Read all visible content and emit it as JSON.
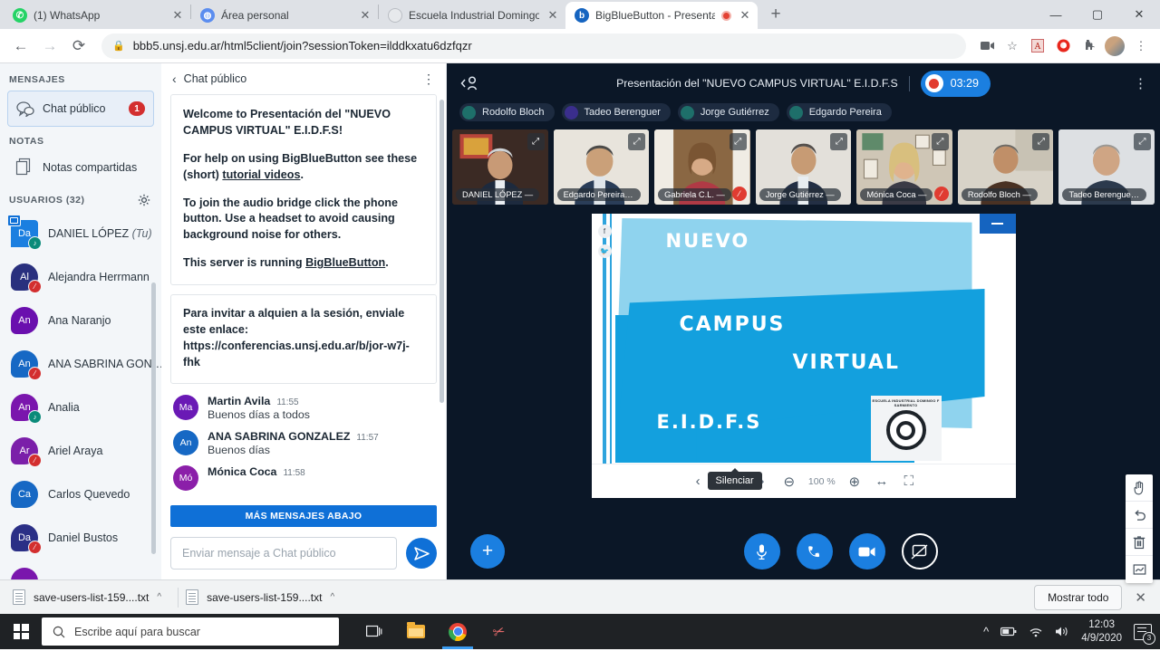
{
  "browser": {
    "tabs": [
      {
        "title": "(1) WhatsApp",
        "favicon": "whatsapp-icon",
        "active": false,
        "recording": false
      },
      {
        "title": "Área personal",
        "favicon": "globe-icon",
        "active": false,
        "recording": false
      },
      {
        "title": "Escuela Industrial Domingo Faust",
        "favicon": "page-icon",
        "active": false,
        "recording": false
      },
      {
        "title": "BigBlueButton - Presentació",
        "favicon": "bigbluebutton-icon",
        "active": true,
        "recording": true
      }
    ],
    "new_tab_label": "+",
    "close_label": "✕",
    "window_controls": {
      "minimize": "—",
      "maximize": "▢",
      "close": "✕"
    },
    "url": "bbb5.unsj.edu.ar/html5client/join?sessionToken=ilddkxatu6dzfqzr",
    "back_label": "←",
    "forward_label": "→",
    "reload_label": "⟳",
    "lock_label": "🔒",
    "toolbar_icons": [
      "camera-icon",
      "bookmark-star-icon",
      "pdf-icon",
      "adblock-icon",
      "extensions-puzzle-icon",
      "profile-avatar",
      "chrome-menu-icon"
    ]
  },
  "sidebar": {
    "messages_label": "MENSAJES",
    "chat_item": {
      "label": "Chat público",
      "unread": "1",
      "icon": "chat-bubbles-icon"
    },
    "notes_label": "NOTAS",
    "notes_item": {
      "label": "Notas compartidas",
      "icon": "notes-pages-icon"
    },
    "users_label": "USUARIOS (32)",
    "settings_icon": "gear-icon",
    "users": [
      {
        "initials": "Da",
        "name": "DANIEL LÓPEZ",
        "suffix": "(Tu)",
        "color": "#1b7fe0",
        "shape": "square",
        "badge": "audio",
        "presenter": true
      },
      {
        "initials": "Al",
        "name": "Alejandra Herrmann",
        "suffix": "",
        "color": "#29307e",
        "shape": "bubble",
        "badge": "muted",
        "presenter": false
      },
      {
        "initials": "An",
        "name": "Ana Naranjo",
        "suffix": "",
        "color": "#6a0fae",
        "shape": "bubble",
        "badge": "none",
        "presenter": false
      },
      {
        "initials": "An",
        "name": "ANA SABRINA GON…",
        "suffix": "",
        "color": "#1668c4",
        "shape": "bubble",
        "badge": "muted",
        "presenter": false
      },
      {
        "initials": "An",
        "name": "Analia",
        "suffix": "",
        "color": "#7a16ad",
        "shape": "bubble",
        "badge": "audio",
        "presenter": false
      },
      {
        "initials": "Ar",
        "name": "Ariel Araya",
        "suffix": "",
        "color": "#7b1fa9",
        "shape": "bubble",
        "badge": "muted",
        "presenter": false
      },
      {
        "initials": "Ca",
        "name": "Carlos Quevedo",
        "suffix": "",
        "color": "#1668c4",
        "shape": "bubble",
        "badge": "none",
        "presenter": false
      },
      {
        "initials": "Da",
        "name": "Daniel Bustos",
        "suffix": "",
        "color": "#2a2f86",
        "shape": "bubble",
        "badge": "muted",
        "presenter": false
      },
      {
        "initials": "",
        "name": "",
        "suffix": "",
        "color": "#7a16ad",
        "shape": "bubble",
        "badge": "none",
        "presenter": false
      }
    ]
  },
  "chat": {
    "header_title": "Chat público",
    "back_icon": "chevron-left-icon",
    "menu_icon": "kebab-menu-icon",
    "welcome": {
      "line1_pre": "Welcome to ",
      "line1_bold": "Presentación del \"NUEVO CAMPUS VIRTUAL\" E.I.D.F.S",
      "line1_post": "!",
      "line2_pre": "For help on using BigBlueButton see these (short) ",
      "line2_link": "tutorial videos",
      "line2_post": ".",
      "line3": "To join the audio bridge click the phone button. Use a headset to avoid causing background noise for others.",
      "line4_pre": "This server is running ",
      "line4_link": "BigBlueButton",
      "line4_post": "."
    },
    "invite": "Para invitar a alquien a la sesión, enviale este enlace: https://conferencias.unsj.edu.ar/b/jor-w7j-fhk",
    "messages": [
      {
        "initials": "Ma",
        "color": "#6a19b5",
        "name": "Martin Avila",
        "time": "11:55",
        "text": "Buenos días a todos"
      },
      {
        "initials": "An",
        "color": "#1668c4",
        "name": "ANA SABRINA GONZALEZ",
        "time": "11:57",
        "text": "Buenos días"
      },
      {
        "initials": "Mó",
        "color": "#8b1fa9",
        "name": "Mónica Coca",
        "time": "11:58",
        "text": ""
      }
    ],
    "more_messages_label": "MÁS MENSAJES ABAJO",
    "input_placeholder": "Enviar mensaje a Chat público",
    "send_icon": "send-paper-plane-icon"
  },
  "meeting": {
    "collapse_icon": "collapse-users-icon",
    "title": "Presentación del \"NUEVO CAMPUS VIRTUAL\" E.I.D.F.S",
    "recording_time": "03:29",
    "recording_icon": "record-dot-icon",
    "options_icon": "kebab-menu-icon",
    "talkers": [
      {
        "name": "Rodolfo Bloch",
        "color": "#1e6f6a"
      },
      {
        "name": "Tadeo Berenguer",
        "color": "#3a2e8c"
      },
      {
        "name": "Jorge Gutiérrez",
        "color": "#1e6f6a"
      },
      {
        "name": "Edgardo Pereira",
        "color": "#1e6f6a"
      }
    ],
    "cameras": [
      {
        "label": "DANIEL LÓPEZ —",
        "muted": false,
        "bg": "#3b2a24",
        "skin": "#c89a76",
        "shirt": "#1d2a3e"
      },
      {
        "label": "Edgardo Pereira —",
        "muted": false,
        "bg": "#e8e4dc",
        "skin": "#caa079",
        "shirt": "#2a3d58"
      },
      {
        "label": "Gabriela C.L. —",
        "muted": true,
        "bg": "#8a6743",
        "skin": "#d7aa86",
        "shirt": "#b03a45"
      },
      {
        "label": "Jorge Gutiérrez —",
        "muted": false,
        "bg": "#e3e0da",
        "skin": "#c79b74",
        "shirt": "#232f44"
      },
      {
        "label": "Mónica Coca —",
        "muted": true,
        "bg": "#cfc6b6",
        "skin": "#e0b38d",
        "shirt": "#3b3b46"
      },
      {
        "label": "Rodolfo Bloch —",
        "muted": false,
        "bg": "#d8d3c8",
        "skin": "#c08f68",
        "shirt": "#4a3224"
      },
      {
        "label": "Tadeo Berenguer —",
        "muted": false,
        "bg": "#dde0e3",
        "skin": "#cfa584",
        "shirt": "#2c3a4d"
      }
    ],
    "expand_icon": "expand-arrows-icon",
    "mute_indicator_icon": "mic-muted-icon"
  },
  "slide": {
    "minimize_icon": "minimize-icon",
    "social": [
      "facebook-icon",
      "twitter-icon"
    ],
    "text_nuevo": "NUEVO",
    "text_campus": "CAMPUS",
    "text_virtual": "VIRTUAL",
    "text_eidfs": "E.I.D.F.S",
    "crest_top": "ESCUELA INDUSTRIAL\nDOMINGO F SARMIENTO",
    "toolbar": {
      "prev_icon": "chevron-left-icon",
      "page_label": "a 1",
      "dropdown_icon": "chevron-down-icon",
      "next_icon": "chevron-right-icon",
      "zoom_out_icon": "minus-circle-icon",
      "zoom_value": "100 %",
      "zoom_in_icon": "plus-circle-icon",
      "fit_width_icon": "fit-width-icon",
      "fullscreen_icon": "fullscreen-icon"
    },
    "tooltip": "Silenciar"
  },
  "tools": [
    {
      "icon": "hand-pointer-icon"
    },
    {
      "icon": "undo-icon"
    },
    {
      "icon": "trash-icon"
    },
    {
      "icon": "whiteboard-icon"
    }
  ],
  "actions": {
    "add_icon": "plus-icon",
    "mic_icon": "microphone-icon",
    "phone_icon": "phone-icon",
    "camera_icon": "video-camera-icon",
    "screenshare_icon": "screen-share-off-icon"
  },
  "downloads": {
    "items": [
      {
        "name": "save-users-list-159....txt",
        "icon": "text-file-icon",
        "caret": "^"
      },
      {
        "name": "save-users-list-159....txt",
        "icon": "text-file-icon",
        "caret": "^"
      }
    ],
    "show_all_label": "Mostrar todo",
    "close_label": "✕"
  },
  "taskbar": {
    "start_icon": "windows-logo-icon",
    "search_placeholder": "Escribe aquí para buscar",
    "search_icon": "magnifier-icon",
    "items": [
      {
        "icon": "task-view-icon"
      },
      {
        "icon": "file-explorer-icon"
      },
      {
        "icon": "chrome-icon",
        "active": true
      },
      {
        "icon": "snipping-tool-icon"
      }
    ],
    "tray": {
      "chevron": "^",
      "icons": [
        "battery-icon",
        "wifi-icon",
        "volume-icon"
      ],
      "time": "12:03",
      "date": "4/9/2020",
      "notifications": "3"
    }
  }
}
